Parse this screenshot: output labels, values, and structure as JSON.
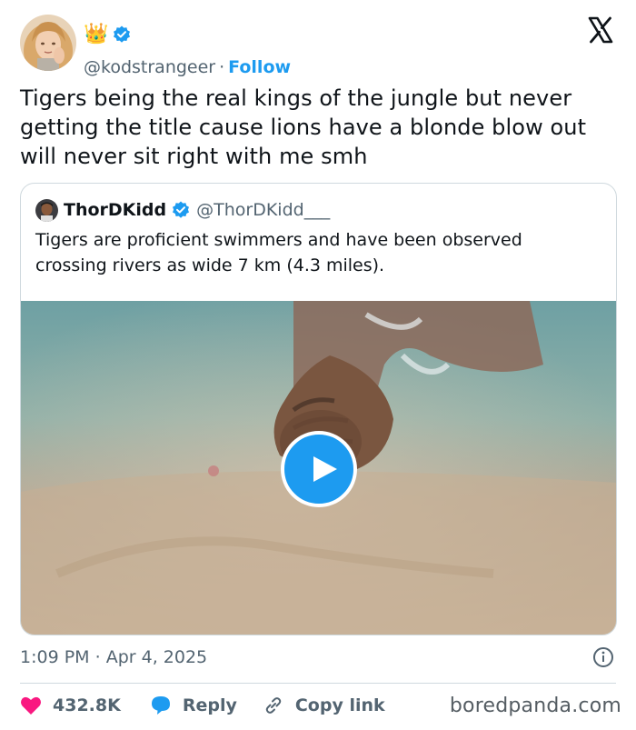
{
  "author": {
    "handle": "@kodstrangeer",
    "follow_label": "Follow",
    "separator": "·",
    "crown_emoji": "👑",
    "verified_icon": "verified-badge-icon"
  },
  "tweet": {
    "text": "Tigers being the real kings of the jungle but never getting the title cause lions have a blonde blow out will never sit right with me smh"
  },
  "quoted_tweet": {
    "name": "ThorDKidd",
    "handle": "@ThorDKidd___",
    "text": "Tigers are proficient swimmers and have been observed crossing rivers as wide 7 km (4.3 miles).",
    "media": "video"
  },
  "timestamp": {
    "time": "1:09 PM",
    "separator": "·",
    "date": "Apr 4, 2025"
  },
  "actions": {
    "likes": "432.8K",
    "reply_label": "Reply",
    "copy_link_label": "Copy link"
  },
  "watermark": "boredpanda.com",
  "colors": {
    "accent": "#1d9bf0",
    "like": "#f91880",
    "text": "#0f1419",
    "muted": "#536471",
    "border": "#cfd9de"
  }
}
